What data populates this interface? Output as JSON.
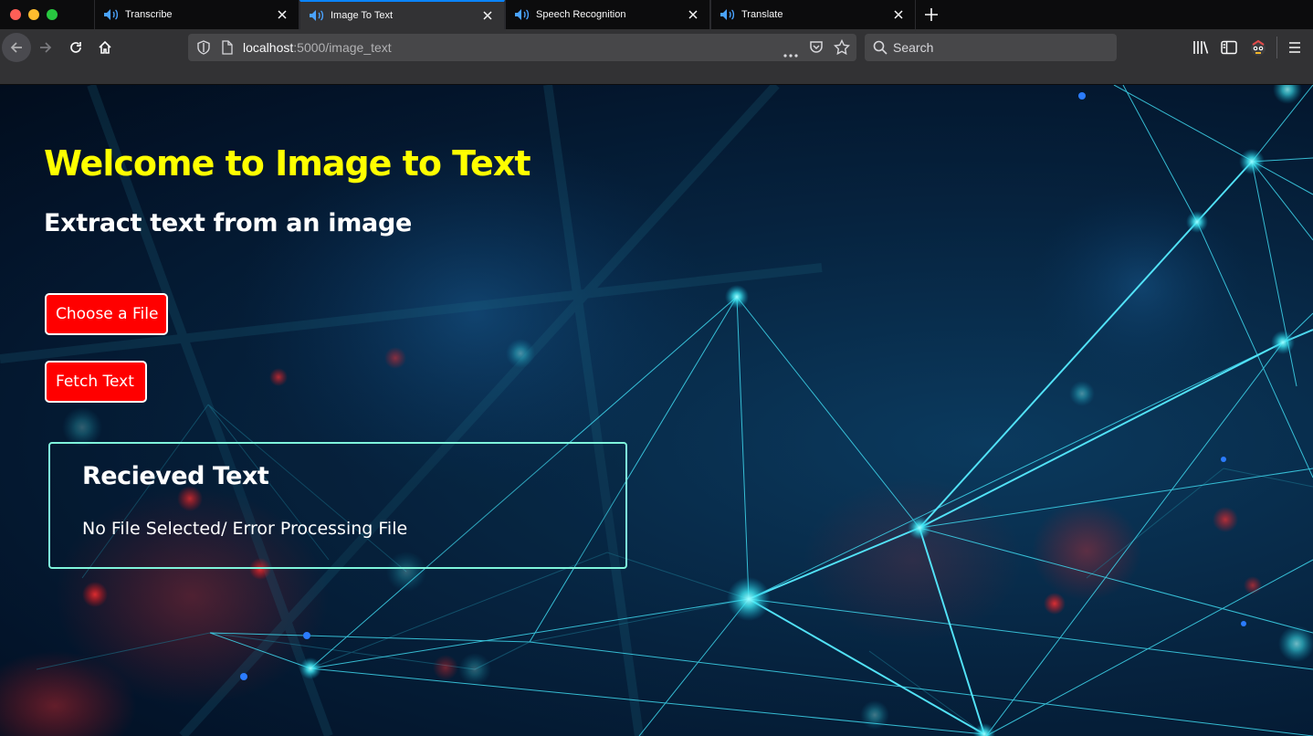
{
  "browser": {
    "tabs": [
      {
        "title": "Transcribe",
        "active": false
      },
      {
        "title": "Image To Text",
        "active": true
      },
      {
        "title": "Speech Recognition",
        "active": false
      },
      {
        "title": "Translate",
        "active": false
      }
    ],
    "url": {
      "host": "localhost",
      "path": ":5000/image_text"
    },
    "search_placeholder": "Search",
    "accent_color": "#0a84ff"
  },
  "page": {
    "title": "Welcome to Image to Text",
    "subtitle": "Extract text from an image",
    "choose_file_label": "Choose a File",
    "fetch_text_label": "Fetch Text",
    "result": {
      "heading": "Recieved Text",
      "text": "No File Selected/ Error Processing File"
    },
    "colors": {
      "title": "#ffff00",
      "button": "#ff0000",
      "result_border": "#7ff5dc"
    }
  }
}
